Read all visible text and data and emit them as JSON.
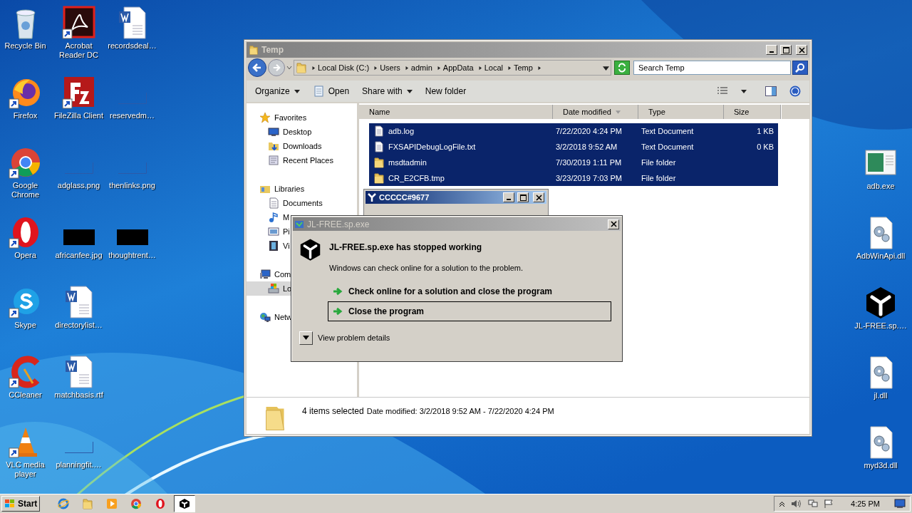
{
  "desktop": {
    "left_columns": [
      {
        "icons": [
          {
            "label": "Recycle Bin",
            "kind": "recycle",
            "shortcut": false
          },
          {
            "label": "Firefox",
            "kind": "firefox",
            "shortcut": true
          },
          {
            "label": "Google Chrome",
            "kind": "chrome",
            "shortcut": true
          },
          {
            "label": "Opera",
            "kind": "opera",
            "shortcut": true
          },
          {
            "label": "Skype",
            "kind": "skype",
            "shortcut": true
          },
          {
            "label": "CCleaner",
            "kind": "ccleaner",
            "shortcut": true
          },
          {
            "label": "VLC media player",
            "kind": "vlc",
            "shortcut": true
          }
        ]
      },
      {
        "icons": [
          {
            "label": "Acrobat Reader DC",
            "kind": "acrobat",
            "shortcut": true
          },
          {
            "label": "FileZilla Client",
            "kind": "filezilla",
            "shortcut": true
          },
          {
            "label": "adglass.png",
            "kind": "thumb"
          },
          {
            "label": "africanfee.jpg",
            "kind": "black"
          },
          {
            "label": "directorylist…",
            "kind": "word",
            "shortcut": false
          },
          {
            "label": "matchbasis.rtf",
            "kind": "word",
            "shortcut": false
          },
          {
            "label": "planningfit.…",
            "kind": "thumb"
          }
        ]
      },
      {
        "icons": [
          {
            "label": "recordsdeal…",
            "kind": "word",
            "shortcut": false
          },
          {
            "label": "reservedm…",
            "kind": "thumb"
          },
          {
            "label": "thenlinks.png",
            "kind": "thumb"
          },
          {
            "label": "thoughtrent…",
            "kind": "black"
          }
        ]
      }
    ],
    "right_icons": [
      {
        "label": "adb.exe",
        "kind": "exe",
        "shortcut": false
      },
      {
        "label": "AdbWinApi.dll",
        "kind": "dll",
        "shortcut": false
      },
      {
        "label": "JL-FREE.sp.…",
        "kind": "cube",
        "shortcut": false
      },
      {
        "label": "jl.dll",
        "kind": "dll",
        "shortcut": false
      },
      {
        "label": "myd3d.dll",
        "kind": "dll",
        "shortcut": false
      }
    ]
  },
  "explorer": {
    "title": "Temp",
    "breadcrumb": [
      "Local Disk (C:)",
      "Users",
      "admin",
      "AppData",
      "Local",
      "Temp"
    ],
    "search": {
      "placeholder": "Search Temp"
    },
    "toolbar": [
      {
        "label": "Organize",
        "kind": "menu"
      },
      {
        "label": "Open",
        "kind": "open"
      },
      {
        "label": "Share with",
        "kind": "menu"
      },
      {
        "label": "New folder",
        "kind": "plain"
      }
    ],
    "nav": [
      {
        "label": "Favorites",
        "kind": "star",
        "selected": false,
        "children": [
          {
            "label": "Desktop",
            "kind": "desktop",
            "selected": false
          },
          {
            "label": "Downloads",
            "kind": "downloads",
            "selected": false
          },
          {
            "label": "Recent Places",
            "kind": "recent",
            "selected": false
          }
        ]
      },
      {
        "label": "Libraries",
        "kind": "library",
        "selected": false,
        "children": [
          {
            "label": "Documents",
            "kind": "docs",
            "selected": false
          },
          {
            "label": "M",
            "kind": "music",
            "selected": false
          },
          {
            "label": "Pi",
            "kind": "pictures",
            "selected": false
          },
          {
            "label": "Vi",
            "kind": "videos",
            "selected": false
          }
        ]
      },
      {
        "label": "Com",
        "kind": "computer",
        "selected": false,
        "children": [
          {
            "label": "Lo",
            "kind": "drive",
            "selected": true
          }
        ]
      },
      {
        "label": "Netw",
        "kind": "network",
        "selected": false
      }
    ],
    "columns": [
      {
        "label": "Name",
        "sorted": false
      },
      {
        "label": "Date modified",
        "sorted": true
      },
      {
        "label": "Type",
        "sorted": false
      },
      {
        "label": "Size",
        "sorted": false
      }
    ],
    "rows": [
      {
        "name": "adb.log",
        "kind": "file",
        "date": "7/22/2020 4:24 PM",
        "type": "Text Document",
        "size": "1 KB",
        "selected": true
      },
      {
        "name": "FXSAPIDebugLogFile.txt",
        "kind": "file",
        "date": "3/2/2018 9:52 AM",
        "type": "Text Document",
        "size": "0 KB",
        "selected": true
      },
      {
        "name": "msdtadmin",
        "kind": "folder",
        "date": "7/30/2019 1:11 PM",
        "type": "File folder",
        "selected": true
      },
      {
        "name": "CR_E2CFB.tmp",
        "kind": "folder",
        "date": "3/23/2019 7:03 PM",
        "type": "File folder",
        "selected": true
      }
    ],
    "status": {
      "count": "4 items selected",
      "detail": "Date modified: 3/2/2018 9:52 AM - 7/22/2020 4:24 PM"
    }
  },
  "app_window": {
    "title": "CCCCC#9677"
  },
  "error_dialog": {
    "title": "JL-FREE.sp.exe",
    "heading": "JL-FREE.sp.exe has stopped working",
    "message": "Windows can check online for a solution to the problem.",
    "options": [
      {
        "label": "Check online for a solution and close the program",
        "focused": false
      },
      {
        "label": "Close the program",
        "focused": true
      }
    ],
    "details_label": "View problem details"
  },
  "taskbar": {
    "start": "Start",
    "items": [
      {
        "kind": "ie",
        "active": false
      },
      {
        "kind": "folder",
        "active": false
      },
      {
        "kind": "media",
        "active": false
      },
      {
        "kind": "chrome",
        "active": false
      },
      {
        "kind": "opera",
        "active": false
      },
      {
        "kind": "cube",
        "active": true
      }
    ],
    "time": "4:25 PM"
  }
}
